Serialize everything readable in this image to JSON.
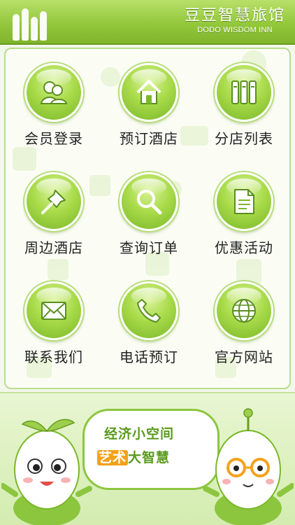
{
  "header": {
    "brand_cn": "豆豆智慧旅馆",
    "brand_en": "DODO WISDOM INN"
  },
  "menu": [
    {
      "label": "会员登录",
      "icon": "member-icon"
    },
    {
      "label": "预订酒店",
      "icon": "home-icon"
    },
    {
      "label": "分店列表",
      "icon": "branch-list-icon"
    },
    {
      "label": "周边酒店",
      "icon": "pin-icon"
    },
    {
      "label": "查询订单",
      "icon": "search-icon"
    },
    {
      "label": "优惠活动",
      "icon": "document-icon"
    },
    {
      "label": "联系我们",
      "icon": "mail-icon"
    },
    {
      "label": "电话预订",
      "icon": "phone-icon"
    },
    {
      "label": "官方网站",
      "icon": "globe-icon"
    }
  ],
  "banner": {
    "slogan_line1": "经济小空间",
    "slogan_line2_prefix": "艺术",
    "slogan_line2_rest": "大智慧"
  },
  "colors": {
    "accent": "#93c83c",
    "highlight": "#f3a21c"
  }
}
